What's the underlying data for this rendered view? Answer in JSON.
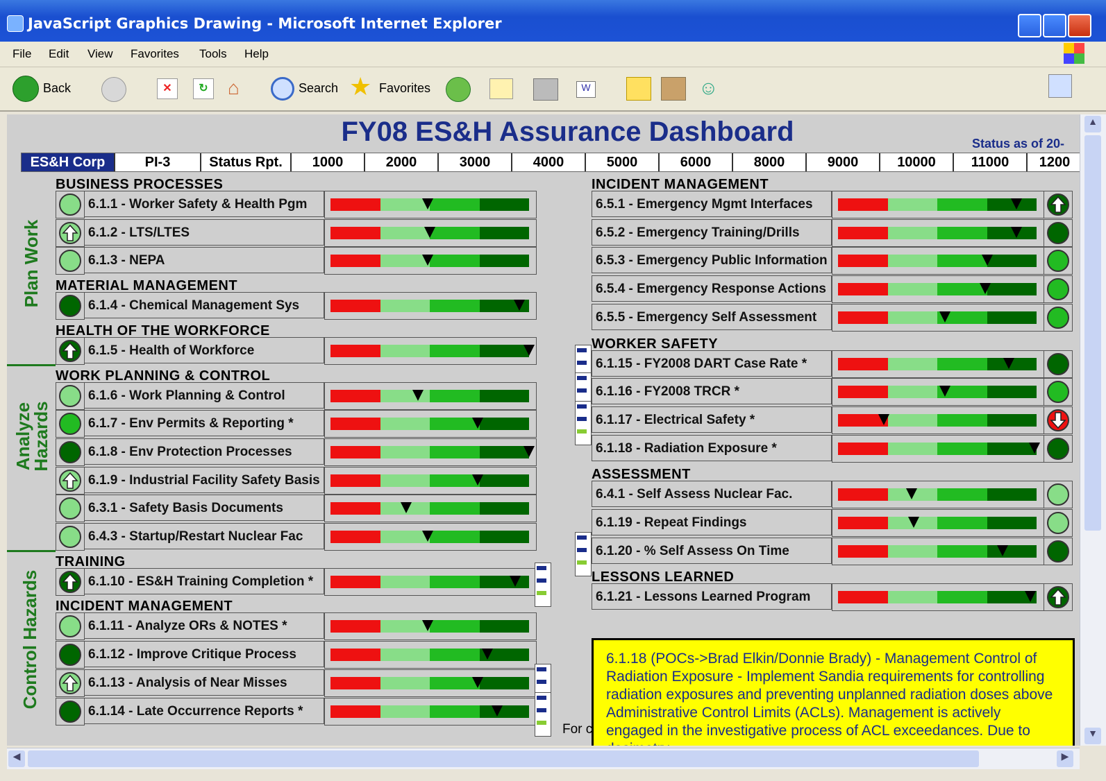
{
  "window": {
    "title": "JavaScript Graphics Drawing - Microsoft Internet Explorer"
  },
  "menu": [
    "File",
    "Edit",
    "View",
    "Favorites",
    "Tools",
    "Help"
  ],
  "toolbar": {
    "back": "Back",
    "search": "Search",
    "favorites": "Favorites"
  },
  "dashboard": {
    "title": "FY08 ES&H Assurance Dashboard",
    "status_as_of": "Status as of 20-",
    "header_cells": [
      "ES&H Corp",
      "PI-3",
      "Status Rpt.",
      "1000",
      "2000",
      "3000",
      "4000",
      "5000",
      "6000",
      "8000",
      "9000",
      "10000",
      "11000",
      "1200"
    ],
    "side_labels": [
      "Plan Work",
      "Analyze Hazards",
      "Control Hazards"
    ],
    "gauge_colors": {
      "red": "#ee1111",
      "light": "#88dd88",
      "mid": "#22bb22",
      "dark": "#006600"
    },
    "left_sections": [
      {
        "title": "BUSINESS PROCESSES",
        "rows": [
          {
            "label": "6.1.1 - Worker Safety & Health Pgm",
            "status": "light-circle",
            "marker": 0.49
          },
          {
            "label": "6.1.2 - LTS/LTES",
            "status": "light-up",
            "marker": 0.5
          },
          {
            "label": "6.1.3 - NEPA",
            "status": "light-circle",
            "marker": 0.49
          }
        ]
      },
      {
        "title": "MATERIAL MANAGEMENT",
        "rows": [
          {
            "label": "6.1.4 - Chemical Management Sys",
            "status": "dark-circle",
            "marker": 0.95
          }
        ]
      },
      {
        "title": "HEALTH OF THE WORKFORCE",
        "rows": [
          {
            "label": "6.1.5 - Health of Workforce",
            "status": "dark-up",
            "marker": 1.0
          }
        ]
      },
      {
        "title": "WORK PLANNING & CONTROL",
        "rows": [
          {
            "label": "6.1.6 - Work Planning & Control",
            "status": "light-circle",
            "marker": 0.44
          },
          {
            "label": "6.1.7 - Env Permits & Reporting *",
            "status": "mid-circle",
            "marker": 0.74
          },
          {
            "label": "6.1.8 - Env Protection Processes",
            "status": "dark-circle",
            "marker": 1.0
          },
          {
            "label": "6.1.9 - Industrial Facility Safety Basis",
            "status": "light-up",
            "marker": 0.74
          },
          {
            "label": "6.3.1 - Safety Basis Documents",
            "status": "light-circle",
            "marker": 0.38
          },
          {
            "label": "6.4.3 - Startup/Restart Nuclear Fac",
            "status": "light-circle",
            "marker": 0.49
          }
        ]
      },
      {
        "title": "TRAINING",
        "rows": [
          {
            "label": "6.1.10 - ES&H Training Completion *",
            "status": "dark-up",
            "marker": 0.93,
            "flag": true
          }
        ]
      },
      {
        "title": "INCIDENT MANAGEMENT",
        "rows": [
          {
            "label": "6.1.11 - Analyze ORs & NOTES *",
            "status": "light-circle",
            "marker": 0.49
          },
          {
            "label": "6.1.12 - Improve Critique Process",
            "status": "dark-circle",
            "marker": 0.79
          },
          {
            "label": "6.1.13 - Analysis of Near Misses",
            "status": "light-up",
            "marker": 0.74,
            "flag": true
          },
          {
            "label": "6.1.14 - Late Occurrence Reports *",
            "status": "dark-circle",
            "marker": 0.84,
            "flag": true
          }
        ]
      }
    ],
    "right_sections": [
      {
        "title": "INCIDENT MANAGEMENT",
        "rows": [
          {
            "label": "6.5.1 - Emergency Mgmt Interfaces",
            "status": "dark-up",
            "marker": 0.9
          },
          {
            "label": "6.5.2 - Emergency Training/Drills",
            "status": "dark-circle",
            "marker": 0.9
          },
          {
            "label": "6.5.3 - Emergency Public Information",
            "status": "mid-circle",
            "marker": 0.75
          },
          {
            "label": "6.5.4 - Emergency Response Actions",
            "status": "mid-circle",
            "marker": 0.74
          },
          {
            "label": "6.5.5 - Emergency Self Assessment",
            "status": "mid-circle",
            "marker": 0.54
          }
        ]
      },
      {
        "title": "WORKER SAFETY",
        "rows": [
          {
            "label": "6.1.15 - FY2008 DART Case Rate *",
            "status": "dark-circle",
            "marker": 0.86,
            "flag": true
          },
          {
            "label": "6.1.16 - FY2008 TRCR *",
            "status": "mid-circle",
            "marker": 0.54,
            "flag": true
          },
          {
            "label": "6.1.17 - Electrical Safety *",
            "status": "red-down",
            "marker": 0.23,
            "flag": true
          },
          {
            "label": "6.1.18 - Radiation Exposure *",
            "status": "dark-circle",
            "marker": 0.99
          }
        ]
      },
      {
        "title": "ASSESSMENT",
        "rows": [
          {
            "label": "6.4.1 - Self Assess Nuclear Fac.",
            "status": "light-circle",
            "marker": 0.37
          },
          {
            "label": "6.1.19 - Repeat Findings",
            "status": "light-circle",
            "marker": 0.38
          },
          {
            "label": "6.1.20 - % Self Assess On Time",
            "status": "dark-circle",
            "marker": 0.83,
            "flag": true
          }
        ]
      },
      {
        "title": "LESSONS LEARNED",
        "rows": [
          {
            "label": "6.1.21 - Lessons Learned Program",
            "status": "dark-up",
            "marker": 0.97
          }
        ]
      }
    ],
    "note": "6.1.18 (POCs->Brad Elkin/Donnie Brady) - Management Control of Radiation Exposure - Implement Sandia requirements for controlling radiation exposures and preventing unplanned radiation doses above Administrative Control Limits (ACLs). Management is actively engaged in the investigative process of ACL exceedances. Due to dosimetry",
    "for_text": "For c"
  }
}
